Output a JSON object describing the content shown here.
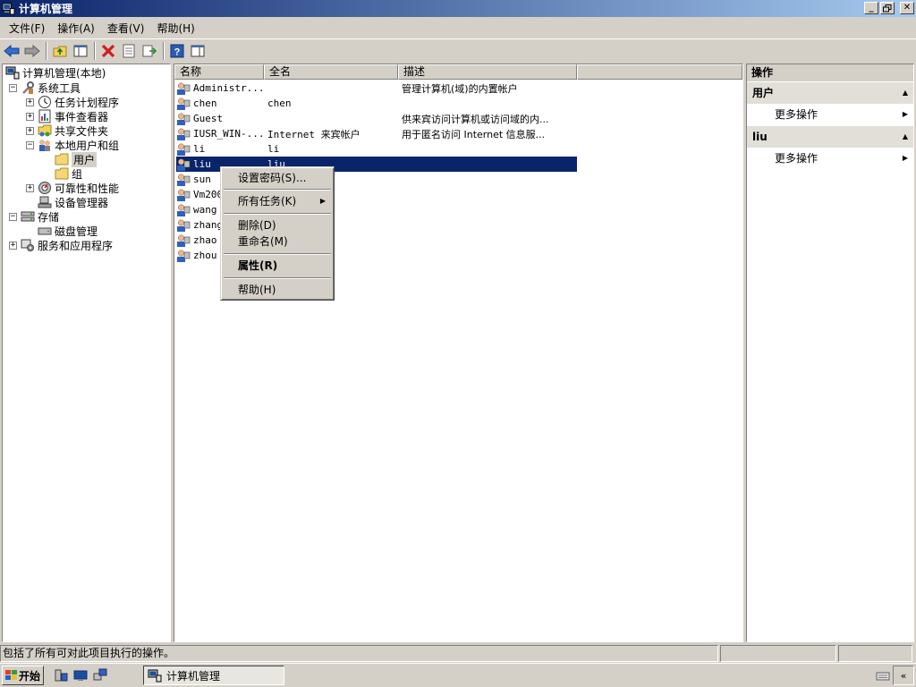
{
  "window": {
    "title": "计算机管理"
  },
  "menubar": [
    {
      "label": "文件(F)"
    },
    {
      "label": "操作(A)"
    },
    {
      "label": "查看(V)"
    },
    {
      "label": "帮助(H)"
    }
  ],
  "toolbar": {
    "icons": [
      "back-arrow-icon",
      "forward-arrow-icon",
      "up-folder-icon",
      "show-hide-tree-icon",
      "delete-icon",
      "properties-icon",
      "export-list-icon",
      "help-icon",
      "show-hide-action-pane-icon"
    ]
  },
  "tree": {
    "root": "计算机管理(本地)",
    "system_tools": "系统工具",
    "task_scheduler": "任务计划程序",
    "event_viewer": "事件查看器",
    "shared_folders": "共享文件夹",
    "local_users_groups": "本地用户和组",
    "users": "用户",
    "groups": "组",
    "reliability": "可靠性和性能",
    "device_manager": "设备管理器",
    "storage": "存储",
    "disk_management": "磁盘管理",
    "services_apps": "服务和应用程序",
    "expanded_symbol": "−",
    "collapsed_symbol": "+"
  },
  "list": {
    "columns": [
      "名称",
      "全名",
      "描述"
    ],
    "rows": [
      {
        "name": "Administr...",
        "fullname": "",
        "desc": "管理计算机(域)的内置帐户"
      },
      {
        "name": "chen",
        "fullname": "chen",
        "desc": ""
      },
      {
        "name": "Guest",
        "fullname": "",
        "desc": "供来宾访问计算机或访问域的内..."
      },
      {
        "name": "IUSR_WIN-...",
        "fullname": "Internet 来宾帐户",
        "desc": "用于匿名访问 Internet 信息服..."
      },
      {
        "name": "li",
        "fullname": "li",
        "desc": ""
      },
      {
        "name": "liu",
        "fullname": "liu",
        "desc": ""
      },
      {
        "name": "sun",
        "fullname": "",
        "desc": ""
      },
      {
        "name": "Vm200",
        "fullname": "",
        "desc": ""
      },
      {
        "name": "wang",
        "fullname": "",
        "desc": ""
      },
      {
        "name": "zhang",
        "fullname": "",
        "desc": ""
      },
      {
        "name": "zhao",
        "fullname": "",
        "desc": ""
      },
      {
        "name": "zhou",
        "fullname": "",
        "desc": ""
      }
    ],
    "selected_index": 5
  },
  "context_menu": {
    "set_password": "设置密码(S)...",
    "all_tasks": "所有任务(K)",
    "delete": "删除(D)",
    "rename": "重命名(M)",
    "properties": "属性(R)",
    "help": "帮助(H)",
    "submenu_arrow": "▶"
  },
  "actions": {
    "title": "操作",
    "section1": "用户",
    "section2": "liu",
    "more": "更多操作",
    "collapse_arrow": "▲",
    "more_arrow": "▶"
  },
  "statusbar": {
    "text": "包括了所有可对此项目执行的操作。"
  },
  "taskbar": {
    "start": "开始",
    "task": "计算机管理",
    "tray_chevron": "«"
  },
  "colors": {
    "selection": "#0a246a",
    "title_gradient_start": "#0a246a",
    "title_gradient_end": "#a6caf0",
    "chrome": "#d4d0c8"
  }
}
